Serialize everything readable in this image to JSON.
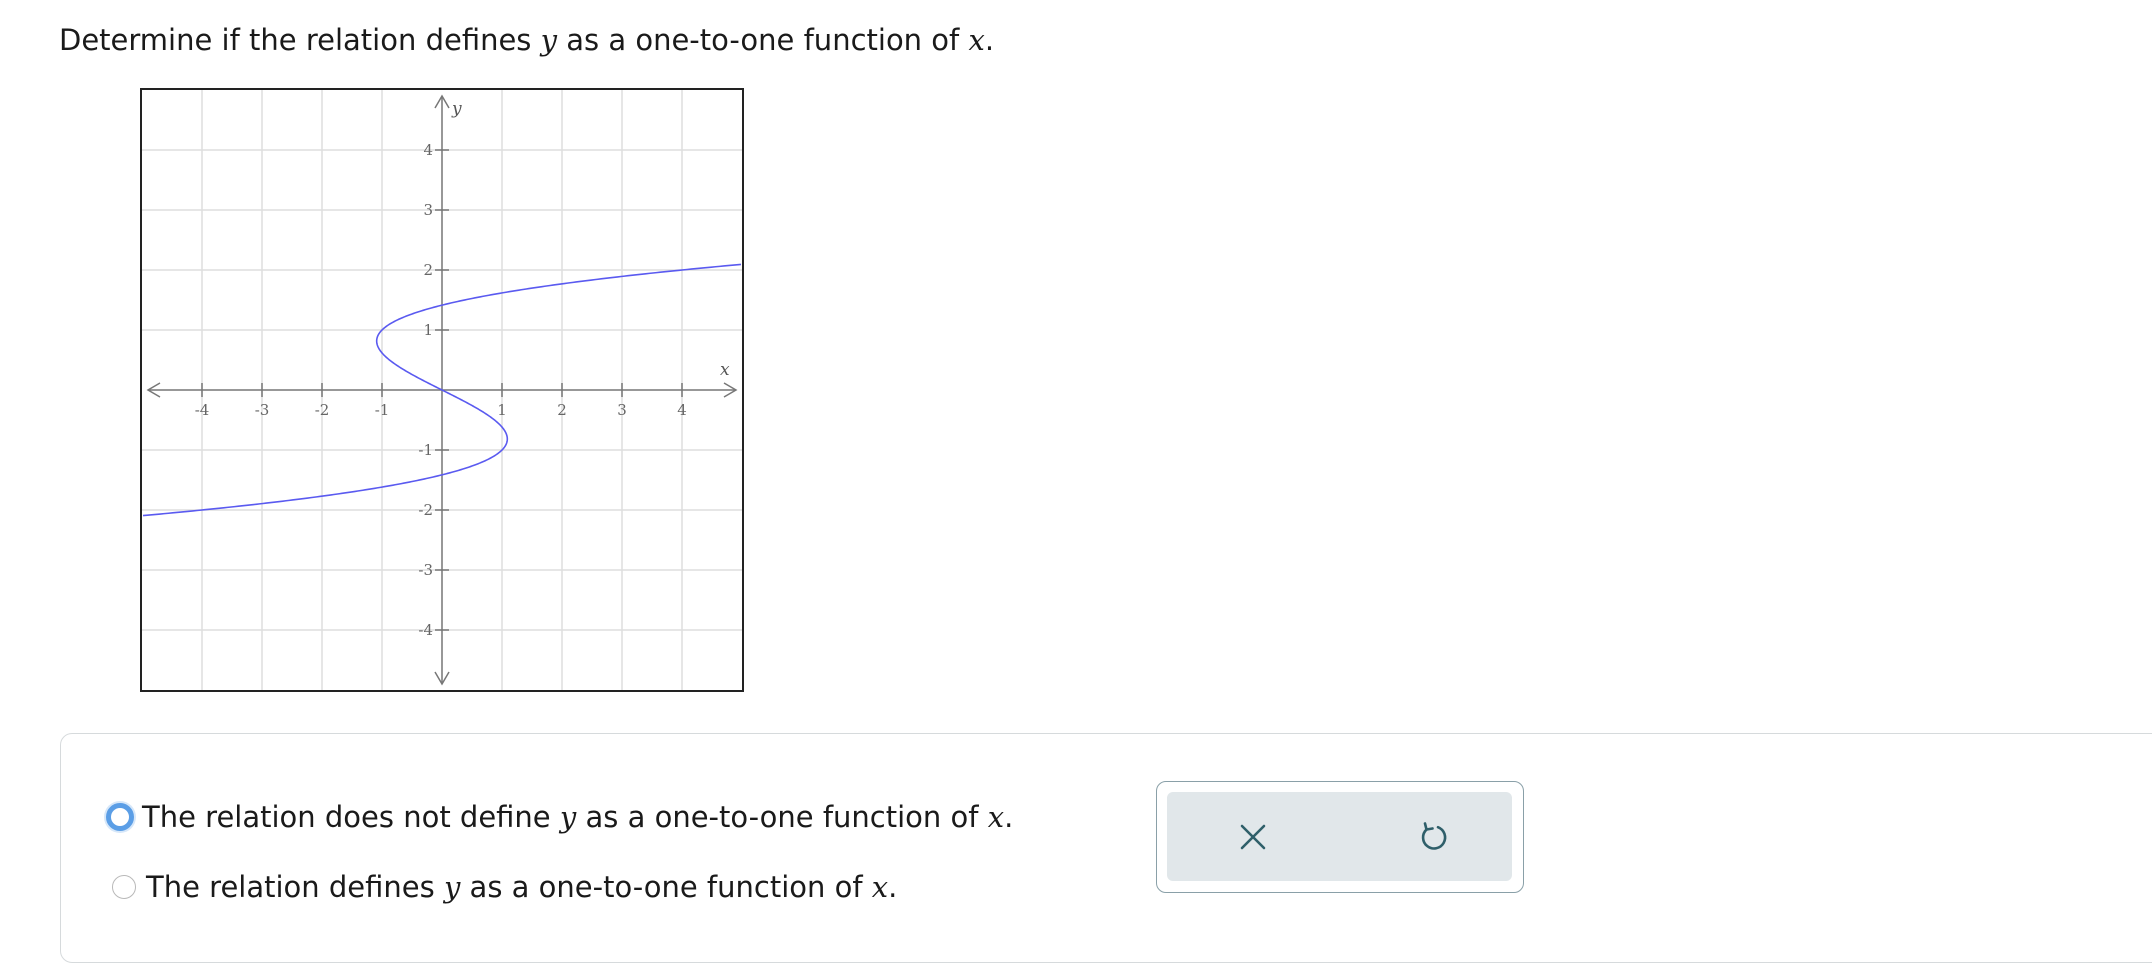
{
  "question": {
    "prefix": "Determine if the relation defines ",
    "var_y": "y",
    "middle": " as a one-to-one function of ",
    "var_x": "x",
    "suffix": "."
  },
  "graph": {
    "x_axis_label": "x",
    "y_axis_label": "y",
    "x_ticks": [
      "-4",
      "-3",
      "-2",
      "-1",
      "1",
      "2",
      "3",
      "4"
    ],
    "y_ticks": [
      "4",
      "3",
      "2",
      "1",
      "-1",
      "-2",
      "-3",
      "-4"
    ],
    "curve_color": "#5a5af0",
    "grid_color": "#dedede"
  },
  "choices": [
    {
      "id": "a",
      "prefix": "The relation does not define ",
      "var_y": "y",
      "middle": " as a one-to-one function of ",
      "var_x": "x",
      "suffix": ".",
      "selected": true
    },
    {
      "id": "b",
      "prefix": "The relation defines ",
      "var_y": "y",
      "middle": " as a one-to-one function of ",
      "var_x": "x",
      "suffix": ".",
      "selected": false
    }
  ],
  "actions": {
    "clear_icon": "close-icon",
    "undo_icon": "undo-icon",
    "icon_color": "#2f5f6a"
  }
}
